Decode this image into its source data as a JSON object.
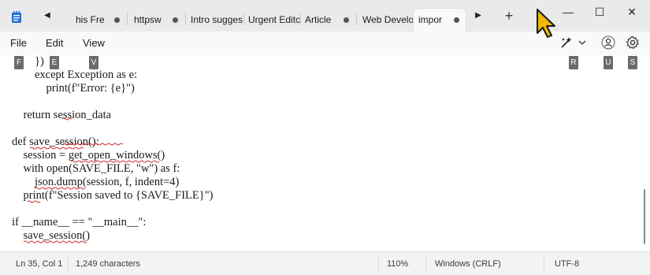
{
  "tabs": [
    {
      "label": "his Fre",
      "modified": true
    },
    {
      "label": "httpsw",
      "modified": true
    },
    {
      "label": "Intro sugges",
      "modified": false
    },
    {
      "label": "Urgent Editc",
      "modified": false
    },
    {
      "label": "Article",
      "modified": true
    },
    {
      "label": "Web Develo",
      "modified": false
    },
    {
      "label": "impor",
      "modified": true,
      "active": true
    }
  ],
  "window_controls": {
    "minimize": "—",
    "maximize": "☐",
    "close": "✕"
  },
  "new_tab_label": "+",
  "menu": {
    "file": "File",
    "edit": "Edit",
    "view": "View"
  },
  "keytips": {
    "file": "F",
    "edit": "E",
    "view": "V",
    "rewrite": "R",
    "user": "U",
    "settings": "S"
  },
  "editor_lines": [
    "        })",
    "        except Exception as e:",
    "            print(f\"Error: {e}\")",
    "",
    "    return session_data",
    "",
    "def save_session():",
    "    session = get_open_windows()",
    "    with open(SAVE_FILE, \"w\") as f:",
    "        json.dump(session, f, indent=4)",
    "    print(f\"Session saved to {SAVE_FILE}\")",
    "",
    "if __name__ == \"__main__\":",
    "    save_session()"
  ],
  "status": {
    "position": "Ln 35, Col 1",
    "characters": "1,249 characters",
    "zoom": "110%",
    "line_ending": "Windows (CRLF)",
    "encoding": "UTF-8"
  },
  "icons": {
    "app": "notepad-icon",
    "rewrite": "copilot-rewrite-icon",
    "account": "account-icon",
    "settings": "gear-icon"
  },
  "colors": {
    "accent": "#0067c0",
    "squiggle": "#d03030",
    "keytip": "#6b6b6b"
  }
}
